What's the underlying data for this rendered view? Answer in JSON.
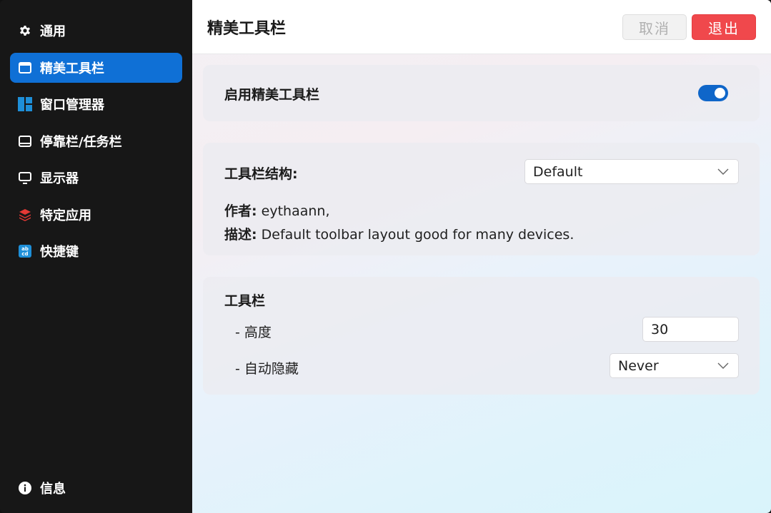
{
  "sidebar": {
    "items": [
      {
        "label": "通用",
        "icon": "gear-icon"
      },
      {
        "label": "精美工具栏",
        "icon": "toolbar-window-icon",
        "active": true
      },
      {
        "label": "窗口管理器",
        "icon": "tiles-icon"
      },
      {
        "label": "停靠栏/任务栏",
        "icon": "taskbar-icon"
      },
      {
        "label": "显示器",
        "icon": "monitor-icon"
      },
      {
        "label": "特定应用",
        "icon": "layers-icon"
      },
      {
        "label": "快捷键",
        "icon": "keyboard-abcd-icon"
      }
    ],
    "info_label": "信息",
    "accent": "#0f70d6"
  },
  "header": {
    "title": "精美工具栏",
    "cancel_label": "取消",
    "exit_label": "退出"
  },
  "enable_card": {
    "label": "启用精美工具栏",
    "enabled": true
  },
  "structure_card": {
    "label": "工具栏结构:",
    "selected": "Default",
    "author_label": "作者:",
    "author_value": " eythaann,",
    "desc_label": "描述:",
    "desc_value": " Default toolbar layout good for many devices."
  },
  "toolbar_card": {
    "title": "工具栏",
    "height_label": "- 高度",
    "height_value": "30",
    "autohide_label": "- 自动隐藏",
    "autohide_value": "Never"
  }
}
